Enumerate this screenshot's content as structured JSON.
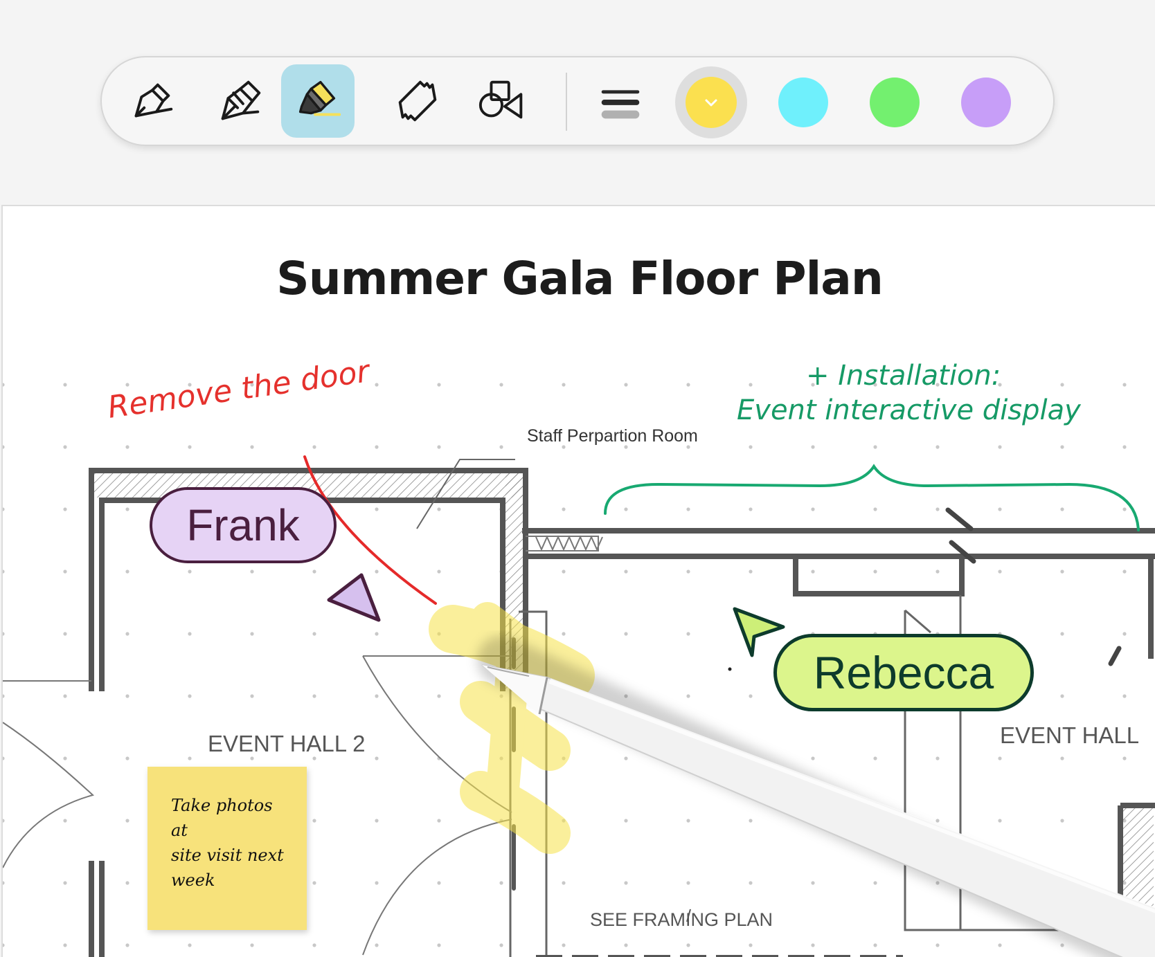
{
  "toolbar": {
    "tools": [
      {
        "name": "pen",
        "active": false
      },
      {
        "name": "fountain-pen",
        "active": false
      },
      {
        "name": "highlighter",
        "active": true
      },
      {
        "name": "eraser",
        "active": false
      },
      {
        "name": "shapes",
        "active": false
      }
    ],
    "line_weight_icon": "line-weight-icon",
    "colors": [
      "#fbe04f",
      "#6ff0fc",
      "#73f06f",
      "#c79ef8"
    ],
    "selected_color": "#fbe04f"
  },
  "document": {
    "title": "Summer Gala Floor Plan",
    "plan_labels": {
      "staff_room": "Staff Perpartion Room",
      "hall_2": "EVENT HALL 2",
      "hall_1": "EVENT HALL",
      "framing": "SEE FRAMING PLAN"
    },
    "annotations": {
      "red_note": "Remove the door",
      "green_note_line1": "+ Installation:",
      "green_note_line2": "Event interactive display",
      "sticky_note": "Take photos at\nsite visit next\nweek"
    },
    "collaborators": [
      {
        "name": "Frank",
        "color": "#e6d3f5",
        "border": "#4a1f3f"
      },
      {
        "name": "Rebecca",
        "color": "#dcf58c",
        "border": "#0d3b2c"
      }
    ]
  }
}
